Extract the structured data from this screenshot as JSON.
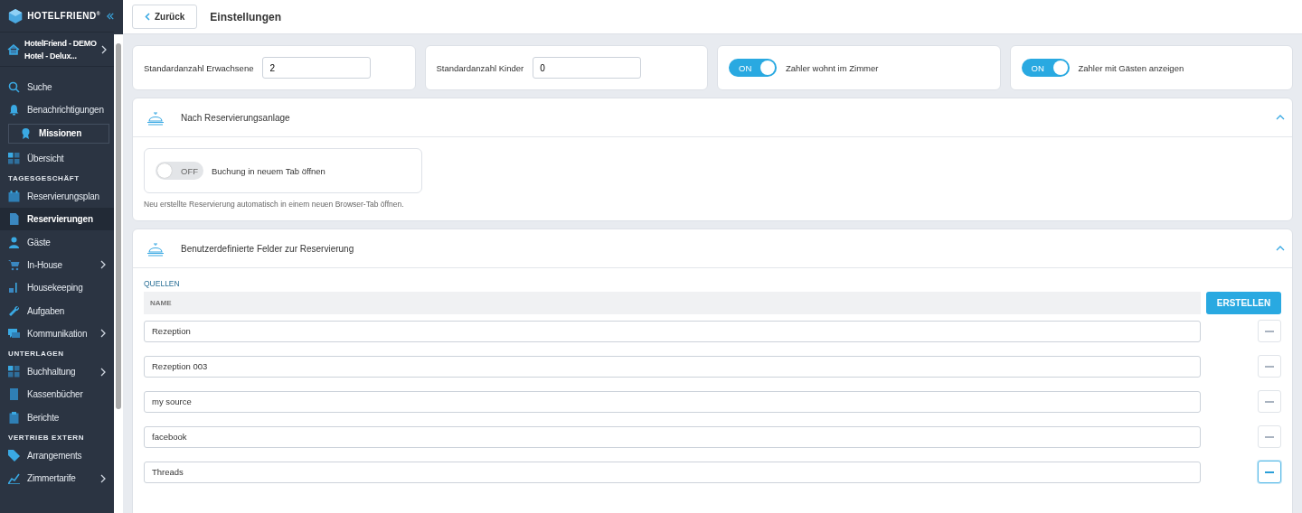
{
  "sidebar": {
    "brand": "HOTELFRIEND",
    "brand_mark": "®",
    "hotel": {
      "line1": "HotelFriend - DEMO",
      "line2": "Hotel - Delux..."
    },
    "items": [
      {
        "kind": "item",
        "label": "Suche",
        "selected": false,
        "submenu": false
      },
      {
        "kind": "item",
        "label": "Benachrichtigungen",
        "selected": false,
        "submenu": false
      },
      {
        "kind": "boxed",
        "label": "Missionen",
        "selected": false,
        "submenu": false
      },
      {
        "kind": "item",
        "label": "Übersicht",
        "selected": false,
        "submenu": false
      },
      {
        "kind": "section",
        "label": "TAGESGESCHÄFT"
      },
      {
        "kind": "item",
        "label": "Reservierungsplan",
        "selected": false,
        "submenu": false
      },
      {
        "kind": "item",
        "label": "Reservierungen",
        "selected": true,
        "submenu": false
      },
      {
        "kind": "item",
        "label": "Gäste",
        "selected": false,
        "submenu": false
      },
      {
        "kind": "item",
        "label": "In-House",
        "selected": false,
        "submenu": true
      },
      {
        "kind": "item",
        "label": "Housekeeping",
        "selected": false,
        "submenu": false
      },
      {
        "kind": "item",
        "label": "Aufgaben",
        "selected": false,
        "submenu": false
      },
      {
        "kind": "item",
        "label": "Kommunikation",
        "selected": false,
        "submenu": true
      },
      {
        "kind": "section",
        "label": "UNTERLAGEN"
      },
      {
        "kind": "item",
        "label": "Buchhaltung",
        "selected": false,
        "submenu": true
      },
      {
        "kind": "item",
        "label": "Kassenbücher",
        "selected": false,
        "submenu": false
      },
      {
        "kind": "item",
        "label": "Berichte",
        "selected": false,
        "submenu": false
      },
      {
        "kind": "section",
        "label": "VERTRIEB EXTERN"
      },
      {
        "kind": "item",
        "label": "Arrangements",
        "selected": false,
        "submenu": false
      },
      {
        "kind": "item",
        "label": "Zimmertarife",
        "selected": false,
        "submenu": true
      }
    ]
  },
  "header": {
    "back_button": "Zurück",
    "title": "Einstellungen"
  },
  "top_cards": [
    {
      "kind": "number",
      "label": "Standardanzahl Erwachsene",
      "value": "2"
    },
    {
      "kind": "number",
      "label": "Standardanzahl Kinder",
      "value": "0"
    },
    {
      "kind": "toggle",
      "label": "Zahler wohnt im Zimmer",
      "on": true,
      "toggle_text": "ON"
    },
    {
      "kind": "toggle",
      "label": "Zahler mit Gästen anzeigen",
      "on": true,
      "toggle_text": "ON"
    }
  ],
  "after_booking": {
    "title": "Nach Reservierungsanlage",
    "expanded": true,
    "toggle": {
      "label": "Buchung in neuem Tab öffnen",
      "on": false,
      "toggle_text": "OFF"
    },
    "hint": "Neu erstellte Reservierung automatisch in einem neuen Browser-Tab öffnen."
  },
  "custom_fields": {
    "title": "Benutzerdefinierte Felder zur Reservierung",
    "expanded": true,
    "group_label": "QUELLEN",
    "column": "NAME",
    "create_button": "ERSTELLEN",
    "sources": [
      {
        "value": "Rezeption",
        "focused": false
      },
      {
        "value": "Rezeption 003",
        "focused": false
      },
      {
        "value": "my source",
        "focused": false
      },
      {
        "value": "facebook",
        "focused": false
      },
      {
        "value": "Threads",
        "focused": true
      }
    ]
  }
}
